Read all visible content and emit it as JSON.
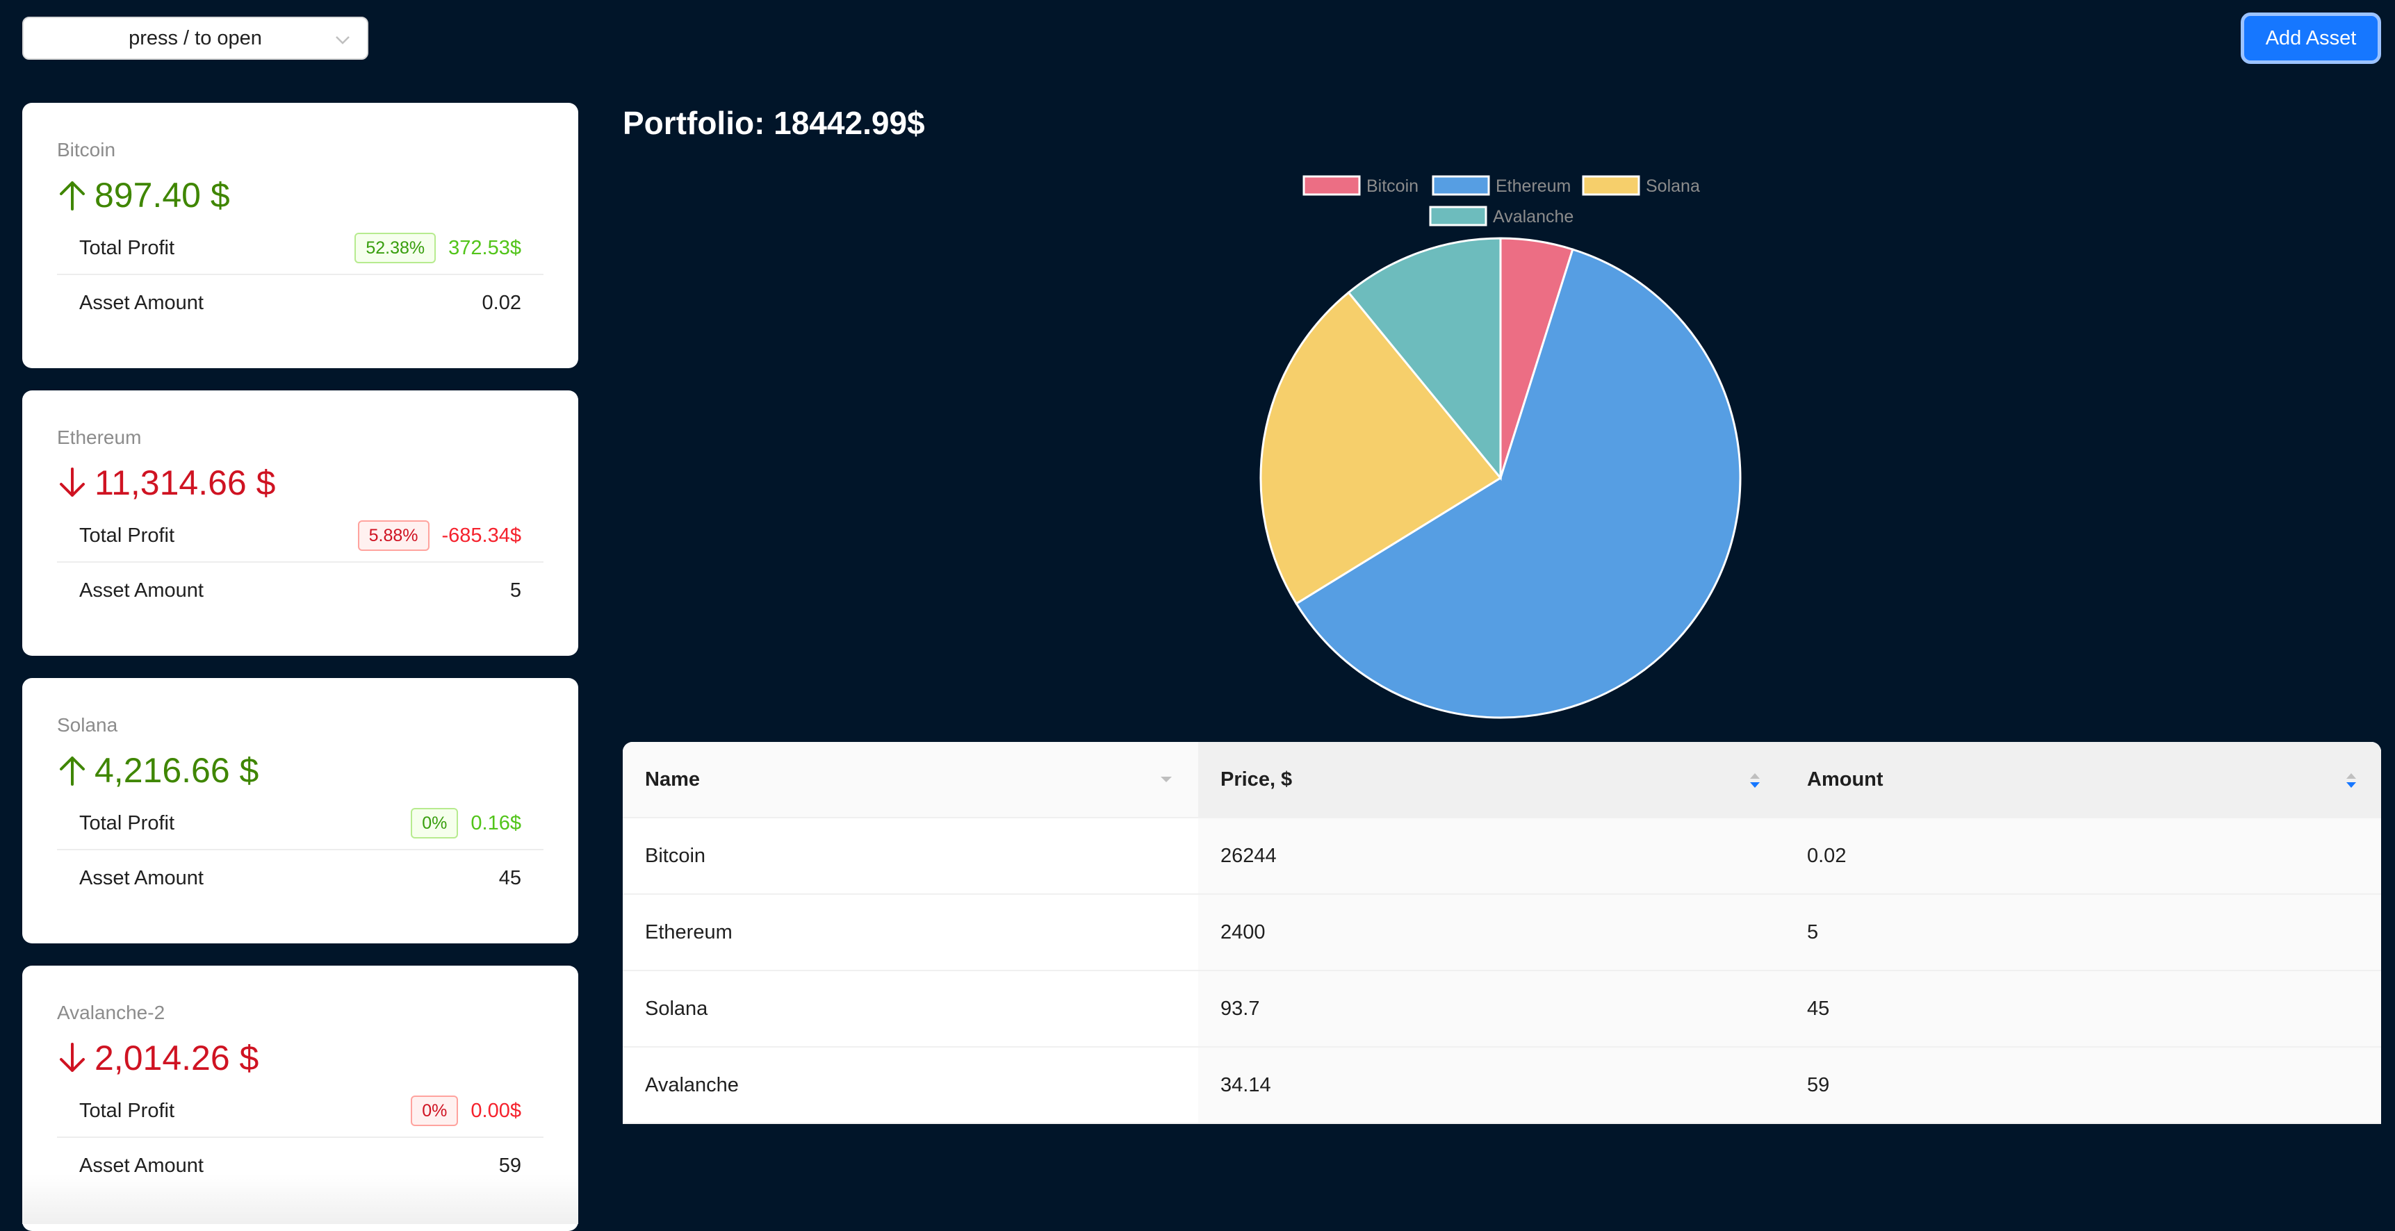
{
  "header": {
    "search_placeholder": "press / to open",
    "add_asset_label": "Add Asset"
  },
  "cards": [
    {
      "name": "Bitcoin",
      "price": "897.40 $",
      "trend": "up",
      "profit_label": "Total Profit",
      "profit_percent": "52.38%",
      "profit_value": "372.53$",
      "profit_color": "green",
      "amount_label": "Asset Amount",
      "amount": "0.02"
    },
    {
      "name": "Ethereum",
      "price": "11,314.66 $",
      "trend": "down",
      "profit_label": "Total Profit",
      "profit_percent": "5.88%",
      "profit_value": "-685.34$",
      "profit_color": "red",
      "amount_label": "Asset Amount",
      "amount": "5"
    },
    {
      "name": "Solana",
      "price": "4,216.66 $",
      "trend": "up",
      "profit_label": "Total Profit",
      "profit_percent": "0%",
      "profit_value": "0.16$",
      "profit_color": "green",
      "amount_label": "Asset Amount",
      "amount": "45"
    },
    {
      "name": "Avalanche-2",
      "price": "2,014.26 $",
      "trend": "down",
      "profit_label": "Total Profit",
      "profit_percent": "0%",
      "profit_value": "0.00$",
      "profit_color": "red",
      "amount_label": "Asset Amount",
      "amount": "59"
    }
  ],
  "portfolio": {
    "title": "Portfolio: 18442.99$"
  },
  "chart_data": {
    "type": "pie",
    "categories": [
      "Bitcoin",
      "Ethereum",
      "Solana",
      "Avalanche"
    ],
    "values": [
      897.4,
      11314.66,
      4216.66,
      2014.26
    ],
    "colors": [
      "#ec6e84",
      "#569ee3",
      "#f6cf6b",
      "#6dbcbd"
    ],
    "legend": "top"
  },
  "table": {
    "headers": [
      "Name",
      "Price, $",
      "Amount"
    ],
    "rows": [
      [
        "Bitcoin",
        "26244",
        "0.02"
      ],
      [
        "Ethereum",
        "2400",
        "5"
      ],
      [
        "Solana",
        "93.7",
        "45"
      ],
      [
        "Avalanche",
        "34.14",
        "59"
      ]
    ]
  },
  "icons": {
    "select": "chevron-down-icon",
    "up": "arrow-up-icon",
    "down": "arrow-down-icon",
    "filter": "filter-caret-icon",
    "sort": "sort-icon"
  }
}
